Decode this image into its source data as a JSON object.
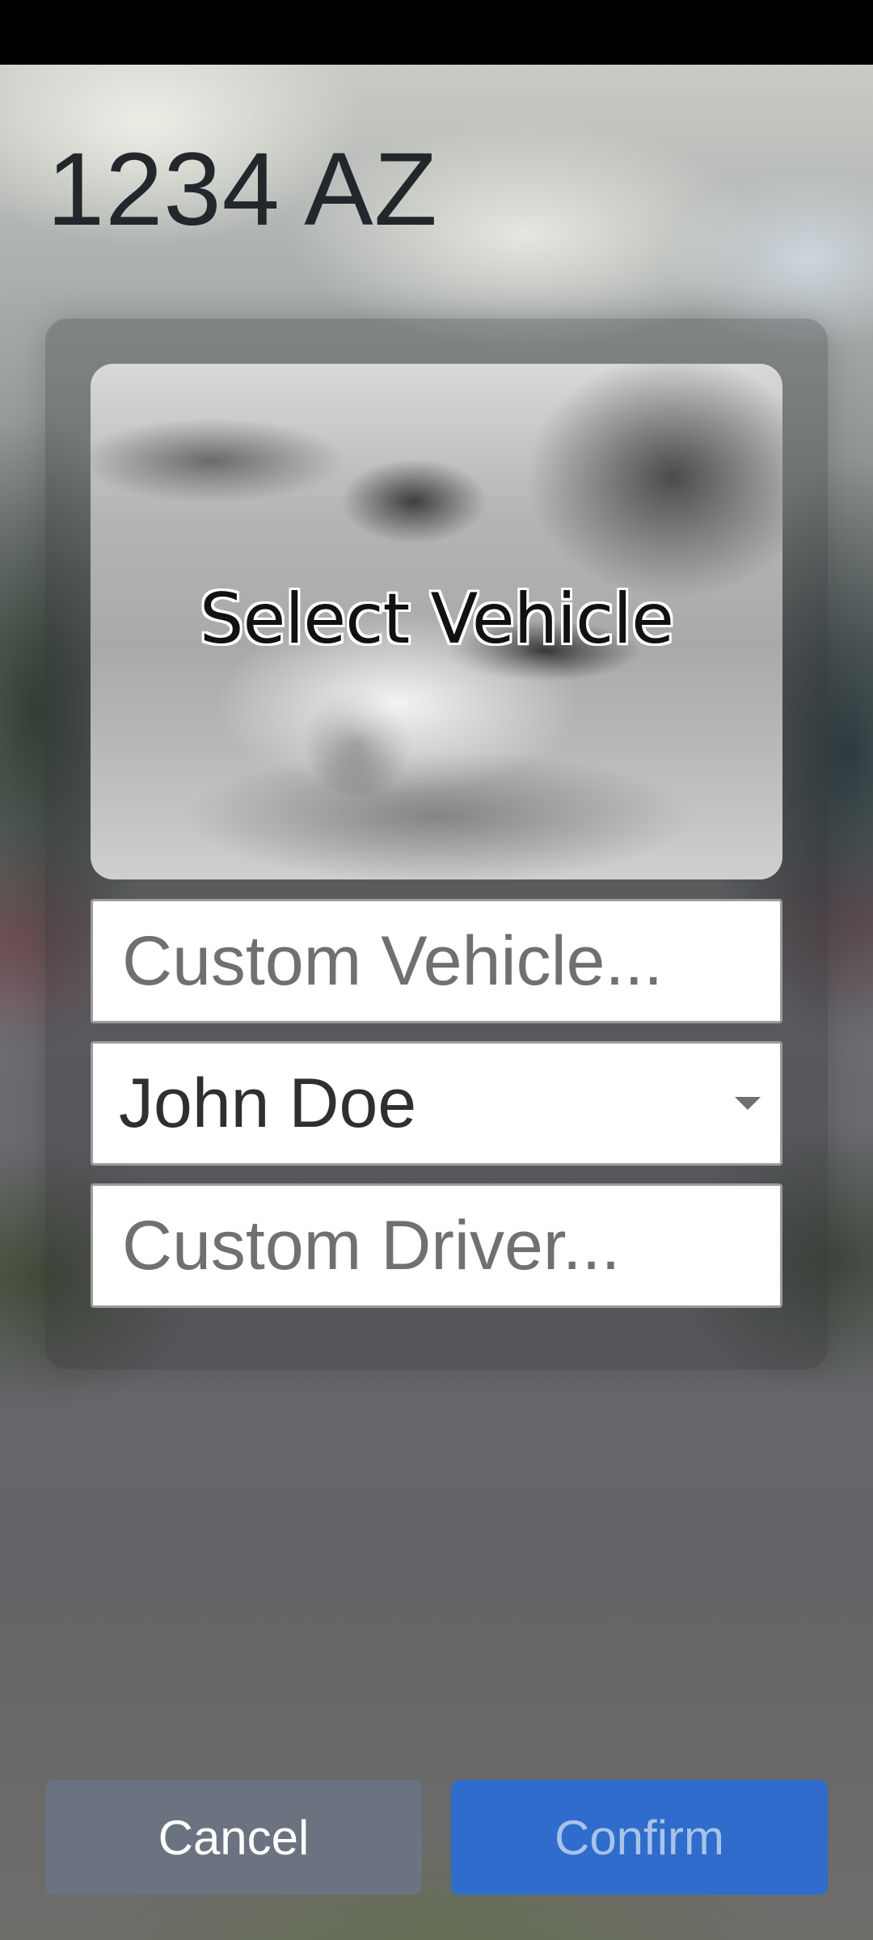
{
  "plate": {
    "number": "1234 AZ"
  },
  "vehicle": {
    "tile_label": "Select Vehicle",
    "custom_placeholder": "Custom Vehicle...",
    "custom_value": ""
  },
  "driver": {
    "selected": "John Doe",
    "custom_placeholder": "Custom Driver...",
    "custom_value": ""
  },
  "actions": {
    "cancel_label": "Cancel",
    "confirm_label": "Confirm"
  },
  "colors": {
    "cancel_bg": "#6b7380",
    "confirm_bg": "#2f6ccc",
    "confirm_text": "#a8c3ea",
    "title_text": "#23262b"
  },
  "icons": {
    "dropdown": "triangle-down"
  }
}
